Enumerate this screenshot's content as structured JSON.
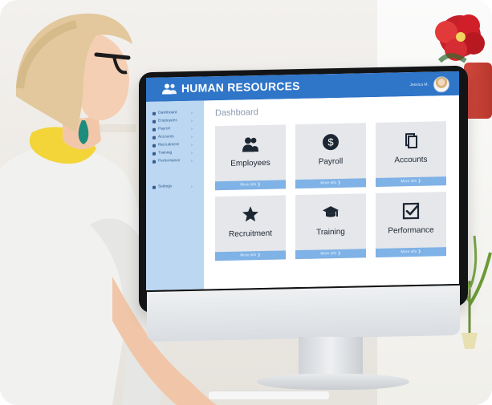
{
  "screen": {
    "brand": "HUMAN RESOURCES",
    "user_name": "Jessica M.",
    "page_title": "Dashboard",
    "sidebar_items": [
      {
        "label": "Dashboard"
      },
      {
        "label": "Employees"
      },
      {
        "label": "Payroll"
      },
      {
        "label": "Accounts"
      },
      {
        "label": "Recruitment"
      },
      {
        "label": "Training"
      },
      {
        "label": "Performance"
      },
      {
        "label": "Settings"
      }
    ],
    "cards": [
      {
        "label": "Employees",
        "more": "More info ❯",
        "icon": "employees-icon"
      },
      {
        "label": "Payroll",
        "more": "More info ❯",
        "icon": "payroll-icon"
      },
      {
        "label": "Accounts",
        "more": "More info ❯",
        "icon": "accounts-icon"
      },
      {
        "label": "Recruitment",
        "more": "More info ❯",
        "icon": "recruitment-icon"
      },
      {
        "label": "Training",
        "more": "More info ❯",
        "icon": "training-icon"
      },
      {
        "label": "Performance",
        "more": "More info ❯",
        "icon": "performance-icon"
      }
    ]
  },
  "colors": {
    "brand_blue": "#2f75c8",
    "sidebar_blue": "#bcd7f2",
    "card_grey": "#e5e7ea",
    "more_blue": "#7fb2e6"
  }
}
